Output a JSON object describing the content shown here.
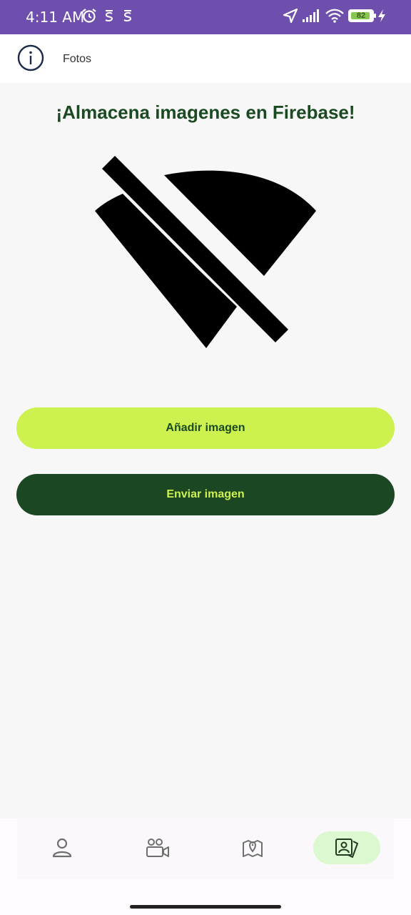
{
  "status_bar": {
    "time": "4:11 AM",
    "battery_level": "82",
    "icons": [
      "alarm-icon",
      "notification-icon",
      "notification-icon",
      "location-arrow-icon",
      "signal-icon",
      "wifi-icon",
      "battery-icon",
      "charging-icon"
    ]
  },
  "app_bar": {
    "icon": "info-icon",
    "title": "Fotos"
  },
  "main": {
    "heading": "¡Almacena imagenes en Firebase!",
    "placeholder_icon": "image-not-supported-icon",
    "add_button_label": "Añadir imagen",
    "send_button_label": "Enviar imagen"
  },
  "bottom_nav": {
    "items": [
      {
        "icon": "person-icon",
        "active": false
      },
      {
        "icon": "video-chat-icon",
        "active": false
      },
      {
        "icon": "map-location-icon",
        "active": false
      },
      {
        "icon": "photo-account-icon",
        "active": true
      }
    ]
  },
  "colors": {
    "status_bar": "#6e4fae",
    "primary_dark": "#1b4723",
    "accent_lime": "#cdf24f",
    "heading": "#1b4a22",
    "nav_active": "#dcf8d0"
  }
}
